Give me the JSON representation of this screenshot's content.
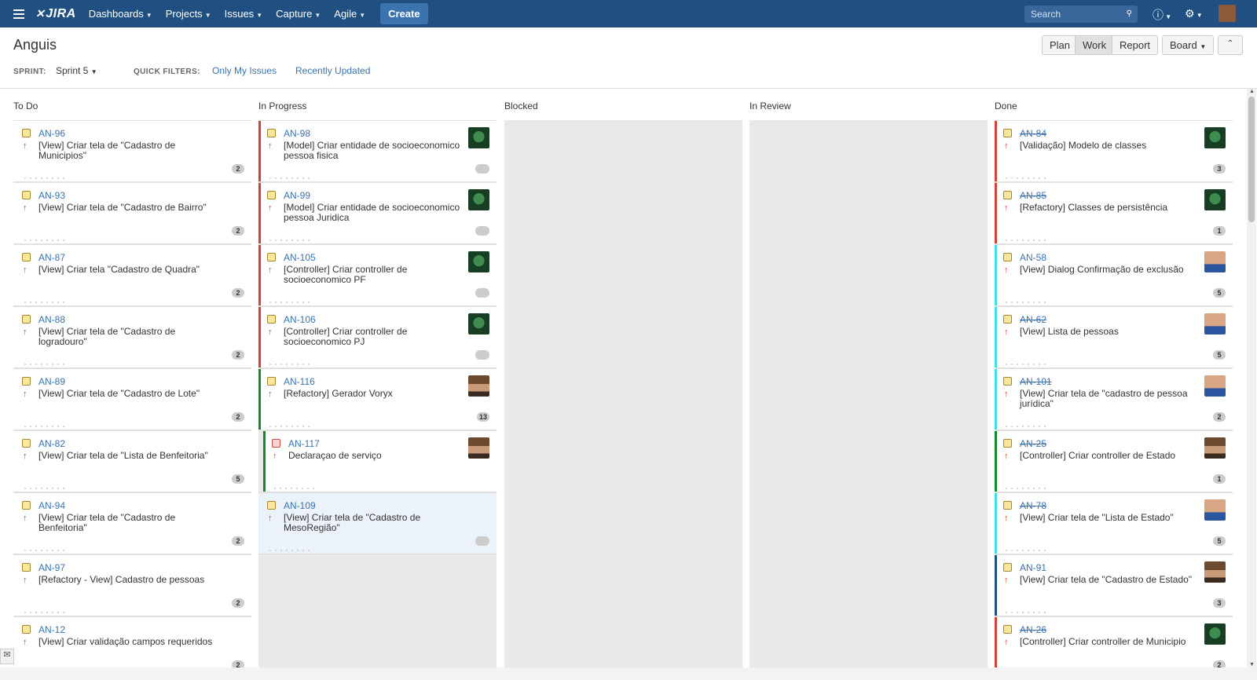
{
  "nav": {
    "logo": "JIRA",
    "items": [
      "Dashboards",
      "Projects",
      "Issues",
      "Capture",
      "Agile"
    ],
    "create": "Create",
    "search_placeholder": "Search"
  },
  "header": {
    "title": "Anguis",
    "buttons": {
      "plan": "Plan",
      "work": "Work",
      "report": "Report",
      "board": "Board"
    },
    "sprint_label": "SPRINT:",
    "sprint_value": "Sprint 5",
    "quick_filters_label": "QUICK FILTERS:",
    "quick_filters": [
      "Only My Issues",
      "Recently Updated"
    ]
  },
  "columns": [
    {
      "name": "To Do",
      "cards": [
        {
          "key": "AN-96",
          "summary": "[View] Criar tela de \"Cadastro de Municipios\"",
          "badge": "2"
        },
        {
          "key": "AN-93",
          "summary": "[View] Criar tela de \"Cadastro de Bairro\"",
          "badge": "2"
        },
        {
          "key": "AN-87",
          "summary": "[View] Criar tela \"Cadastro de Quadra\"",
          "badge": "2"
        },
        {
          "key": "AN-88",
          "summary": "[View] Criar tela de \"Cadastro de logradouro\"",
          "badge": "2"
        },
        {
          "key": "AN-89",
          "summary": "[View] Criar tela de \"Cadastro de Lote\"",
          "badge": "2"
        },
        {
          "key": "AN-82",
          "summary": "[View] Criar tela de \"Lista de Benfeitoria\"",
          "badge": "5"
        },
        {
          "key": "AN-94",
          "summary": "[View] Criar tela de \"Cadastro de Benfeitoria\"",
          "badge": "2"
        },
        {
          "key": "AN-97",
          "summary": "[Refactory - View] Cadastro de pessoas",
          "badge": "2"
        },
        {
          "key": "AN-12",
          "summary": "[View] Criar validação campos requeridos",
          "badge": "2"
        }
      ]
    },
    {
      "name": "In Progress",
      "cards": [
        {
          "key": "AN-98",
          "summary": "[Model] Criar entidade de socioeconomico pessoa fisica",
          "badge": "",
          "bar": "#d04437",
          "avatar": "green"
        },
        {
          "key": "AN-99",
          "summary": "[Model] Criar entidade de socioeconomico pessoa Juridica",
          "badge": "",
          "bar": "#d04437",
          "avatar": "green"
        },
        {
          "key": "AN-105",
          "summary": "[Controller] Criar controller de socioeconomico PF",
          "badge": "",
          "bar": "#d04437",
          "avatar": "green"
        },
        {
          "key": "AN-106",
          "summary": "[Controller] Criar controller de socioeconomico PJ",
          "badge": "",
          "bar": "#d04437",
          "avatar": "green"
        },
        {
          "key": "AN-116",
          "summary": "[Refactory] Gerador Voryx",
          "badge": "13",
          "bar": "#14892c",
          "avatar": "brown"
        },
        {
          "key": "AN-117",
          "summary": "Declaraçao de serviço",
          "badge": "",
          "bar": "#14892c",
          "avatar": "brown"
        },
        {
          "key": "AN-109",
          "summary": "[View] Criar tela de \"Cadastro de MesoRegião\"",
          "badge": "",
          "bar": "",
          "avatar": ""
        }
      ]
    },
    {
      "name": "Blocked",
      "cards": []
    },
    {
      "name": "In Review",
      "cards": []
    },
    {
      "name": "Done",
      "cards": [
        {
          "key": "AN-84",
          "summary": "[Validação] Modelo de classes",
          "badge": "3",
          "bar": "#d04437",
          "avatar": "green"
        },
        {
          "key": "AN-85",
          "summary": "[Refactory] Classes de persistência",
          "badge": "1",
          "bar": "#d04437",
          "avatar": "green"
        },
        {
          "key": "AN-58",
          "summary": "[View] Dialog Confirmação de exclusão",
          "badge": "5",
          "bar": "#3ee1e8",
          "avatar": "blue"
        },
        {
          "key": "AN-62",
          "summary": "[View] Lista de pessoas",
          "badge": "5",
          "bar": "#3ee1e8",
          "avatar": "blue"
        },
        {
          "key": "AN-101",
          "summary": "[View] Criar tela de \"cadastro de pessoa jurídica\"",
          "badge": "2",
          "bar": "#3ee1e8",
          "avatar": "blue"
        },
        {
          "key": "AN-25",
          "summary": "[Controller] Criar controller de Estado",
          "badge": "1",
          "bar": "#14892c",
          "avatar": "brown"
        },
        {
          "key": "AN-78",
          "summary": "[View] Criar tela de \"Lista de Estado\"",
          "badge": "5",
          "bar": "#3ee1e8",
          "avatar": "blue"
        },
        {
          "key": "AN-91",
          "summary": "[View] Criar tela de \"Cadastro de Estado\"",
          "badge": "3",
          "bar": "#205081",
          "avatar": "brown"
        },
        {
          "key": "AN-26",
          "summary": "[Controller] Criar controller de Municipio",
          "badge": "2",
          "bar": "#d04437",
          "avatar": "green"
        }
      ]
    }
  ]
}
